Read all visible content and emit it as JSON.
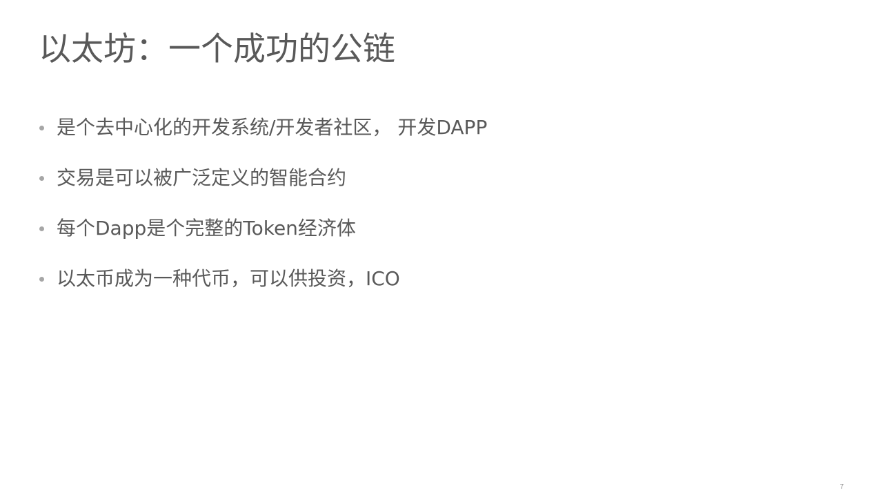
{
  "slide": {
    "title": "以太坊：一个成功的公链",
    "bullets": [
      "是个去中心化的开发系统/开发者社区， 开发DAPP",
      "交易是可以被广泛定义的智能合约",
      "每个Dapp是个完整的Token经济体",
      "以太币成为一种代币，可以供投资，ICO"
    ],
    "page_number": "7"
  }
}
